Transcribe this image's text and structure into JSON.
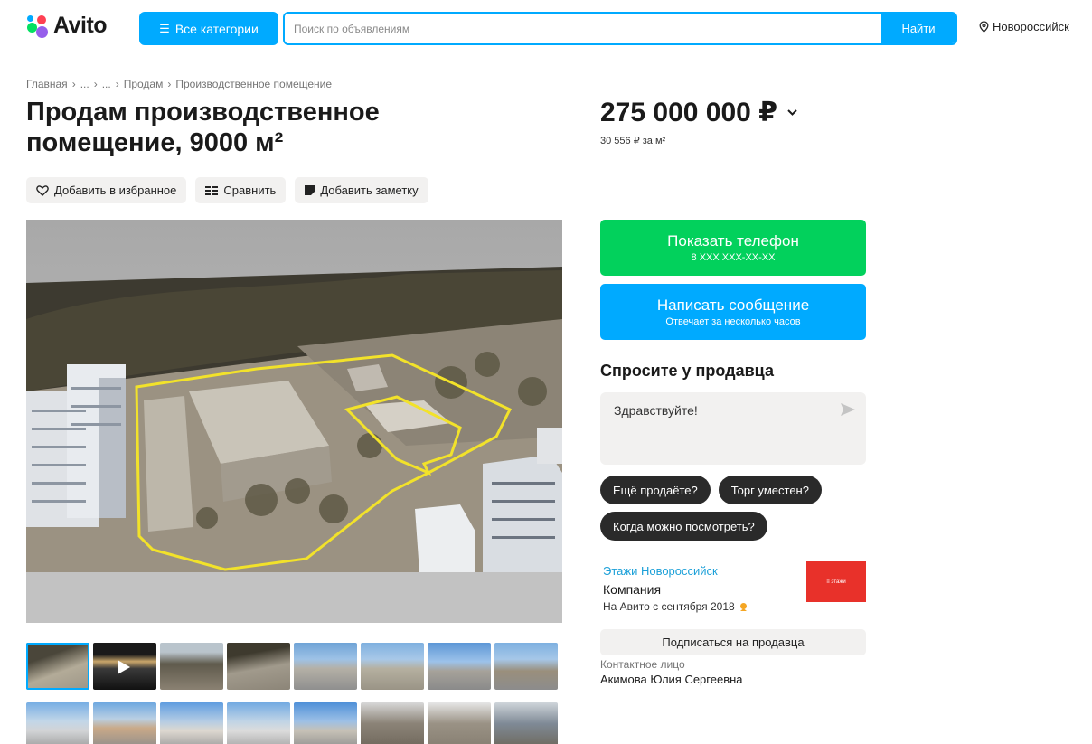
{
  "header": {
    "logo_text": "Avito",
    "categories_label": "Все категории",
    "search_placeholder": "Поиск по объявлениям",
    "search_button": "Найти",
    "city": "Новороссийск"
  },
  "breadcrumb": {
    "items": [
      "Главная",
      "...",
      "...",
      "Продам",
      "Производственное помещение"
    ],
    "separator": "›"
  },
  "listing": {
    "title": "Продам производственное помещение, 9000 м²",
    "price": "275 000 000 ₽",
    "price_per_m2": "30 556 ₽ за м²"
  },
  "actions": {
    "favorite": "Добавить в избранное",
    "compare": "Сравнить",
    "note": "Добавить заметку"
  },
  "contact_buttons": {
    "phone_label": "Показать телефон",
    "phone_mask": "8 XXX XXX-XX-XX",
    "message_label": "Написать сообщение",
    "message_sub": "Отвечает за несколько часов"
  },
  "ask_seller": {
    "title": "Спросите у продавца",
    "message_text": "Здравствуйте!",
    "quick_questions": [
      "Ещё продаёте?",
      "Торг уместен?",
      "Когда можно посмотреть?"
    ]
  },
  "seller": {
    "name": "Этажи Новороссийск",
    "type": "Компания",
    "since": "На Авито с сентября 2018",
    "logo_text": "≡ этажи",
    "subscribe_label": "Подписаться на продавца",
    "contact_label": "Контактное лицо",
    "contact_name": "Акимова Юлия Сергеевна"
  },
  "gallery": {
    "active_index": 0,
    "video_index": 1,
    "thumb_count": 16
  },
  "colors": {
    "accent_blue": "#00aaff",
    "accent_green": "#02d15c",
    "seller_link": "#1ca0d8",
    "chip_dark": "#2a2a2a"
  }
}
